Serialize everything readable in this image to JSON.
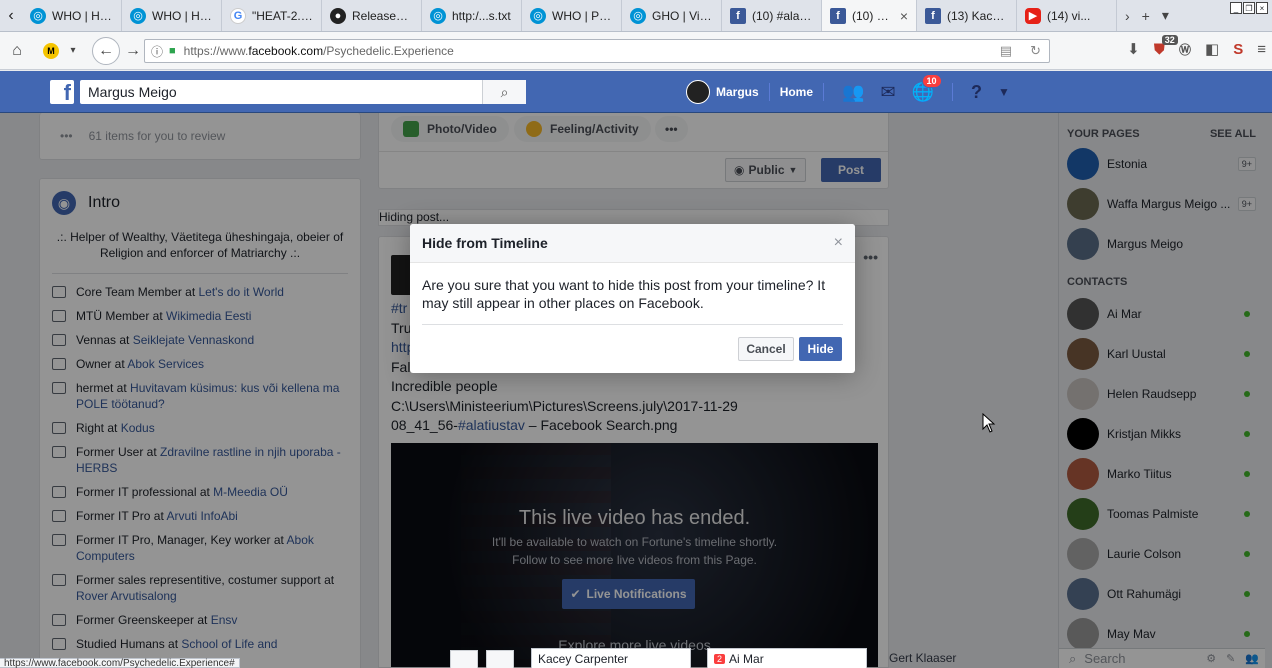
{
  "browser": {
    "tabs": [
      {
        "label": "WHO | He...",
        "icon": "who"
      },
      {
        "label": "WHO | He...",
        "icon": "who"
      },
      {
        "label": "\"HEAT-2.0...",
        "icon": "google"
      },
      {
        "label": "Releases ·...",
        "icon": "github"
      },
      {
        "label": "http:/...s.txt",
        "icon": "who"
      },
      {
        "label": "WHO | Pu...",
        "icon": "who"
      },
      {
        "label": "GHO | Visu...",
        "icon": "who"
      },
      {
        "label": "(10) #alati...",
        "icon": "facebook"
      },
      {
        "label": "(10) M...",
        "icon": "facebook",
        "active": true
      },
      {
        "label": "(13) Kace...",
        "icon": "facebook"
      },
      {
        "label": "(14) vi...",
        "icon": "youtube"
      }
    ],
    "url_prefix": "https://www.",
    "url_domain": "facebook.com",
    "url_path": "/Psychedelic.Experience",
    "addon_badge": "32",
    "status_url": "https://www.facebook.com/Psychedelic.Experience#"
  },
  "fb_header": {
    "search_value": "Margus Meigo",
    "profile_name": "Margus",
    "home_label": "Home",
    "notif_count": "10"
  },
  "left": {
    "review_text": "61 items for you to review",
    "intro_title": "Intro",
    "bio": ".:. Helper of Wealthy, Väetitega üheshingaja, obeier of Religion and enforcer of Matriarchy .:.",
    "work": [
      {
        "pre": "Core Team Member at ",
        "link": "Let's do it World"
      },
      {
        "pre": "MTÜ Member at ",
        "link": "Wikimedia Eesti"
      },
      {
        "pre": "Vennas at ",
        "link": "Seiklejate Vennaskond"
      },
      {
        "pre": "Owner at ",
        "link": "Abok Services"
      },
      {
        "pre": "hermet at ",
        "link": "Huvitavam küsimus: kus või kellena ma POLE töötanud?"
      },
      {
        "pre": "Right at ",
        "link": "Kodus"
      },
      {
        "pre": "Former User at ",
        "link": "Zdravilne rastline in njih uporaba - HERBS"
      },
      {
        "pre": "Former IT professional at ",
        "link": "M-Meedia OÜ"
      },
      {
        "pre": "Former IT Pro at ",
        "link": "Arvuti InfoAbi"
      },
      {
        "pre": "Former IT Pro, Manager, Key worker at ",
        "link": "Abok Computers"
      },
      {
        "pre": "Former sales representitive, costumer support at ",
        "link": "Rover Arvutisalong"
      },
      {
        "pre": "Former Greenskeeper at ",
        "link": "Ensv"
      },
      {
        "pre": "Studied Humans at ",
        "link": "School of Life and"
      }
    ]
  },
  "composer": {
    "photo_label": "Photo/Video",
    "feeling_label": "Feeling/Activity",
    "more": "•••",
    "privacy": "Public",
    "post_label": "Post"
  },
  "hiding_text": "Hiding post...",
  "post": {
    "line1_tag": "#tr",
    "line2": "Tru",
    "line3": "http",
    "line4": "Fal                                                                                          h! !",
    "line5": "Incredible people",
    "line6": "C:\\Users\\Ministeerium\\Pictures\\Screens.july\\2017-11-29",
    "line7_pre": "08_41_56-",
    "line7_tag": "#alatiustav",
    "line7_post": " – Facebook Search.png",
    "video_title": "This live video has ended.",
    "video_sub1": "It'll be available to watch on Fortune's timeline shortly.",
    "video_sub2": "Follow to see more live videos from this Page.",
    "live_btn": "Live Notifications",
    "video_more": "Explore more live videos"
  },
  "modal": {
    "title": "Hide from Timeline",
    "close": "×",
    "body": "Are you sure that you want to hide this post from your timeline? It may still appear in other places on Facebook.",
    "cancel": "Cancel",
    "hide": "Hide"
  },
  "right": {
    "your_pages": "YOUR PAGES",
    "see_all": "SEE ALL",
    "pages": [
      {
        "name": "Estonia",
        "count": "9+",
        "color": "#1f5fb0"
      },
      {
        "name": "Waffa Margus Meigo ...",
        "count": "9+",
        "color": "#6b6a52"
      },
      {
        "name": "Margus Meigo",
        "count": "",
        "color": "#5a6f88"
      }
    ],
    "contacts_title": "CONTACTS",
    "contacts": [
      {
        "name": "Ai Mar",
        "color": "#555"
      },
      {
        "name": "Karl Uustal",
        "color": "#7a5a40"
      },
      {
        "name": "Helen Raudsepp",
        "color": "#c9c3c0"
      },
      {
        "name": "Kristjan Mikks",
        "color": "#000"
      },
      {
        "name": "Marko Tiitus",
        "color": "#b05a40"
      },
      {
        "name": "Toomas Palmiste",
        "color": "#3e6b2a"
      },
      {
        "name": "Laurie Colson",
        "color": "#aaa"
      },
      {
        "name": "Ott Rahumägi",
        "color": "#5a7090"
      },
      {
        "name": "May Mav",
        "color": "#999"
      }
    ],
    "search_placeholder": "Search"
  },
  "chat": {
    "tab1": "Kacey Carpenter",
    "tab2": "Ai Mar",
    "tab2_badge": "2",
    "tab3": "Gert Klaaser"
  }
}
